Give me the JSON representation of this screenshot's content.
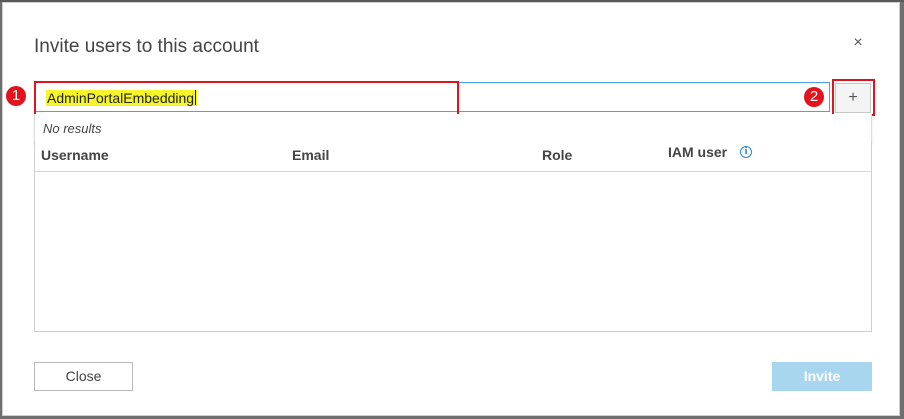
{
  "dialog": {
    "title": "Invite users to this account",
    "close_glyph": "×",
    "close_icon": "close-icon"
  },
  "search": {
    "value": "AdminPortalEmbedding",
    "dropdown_message": "No results"
  },
  "add_button": {
    "glyph": "+",
    "icon": "plus-icon"
  },
  "annotations": {
    "marker_1": "1",
    "marker_2": "2",
    "highlight_color": "#e0141e"
  },
  "table": {
    "columns": [
      "Username",
      "Email",
      "Role",
      "IAM user"
    ],
    "info_icon": "info-icon",
    "rows": []
  },
  "footer": {
    "close_label": "Close",
    "invite_label": "Invite",
    "invite_color": "#a8d6ef"
  }
}
